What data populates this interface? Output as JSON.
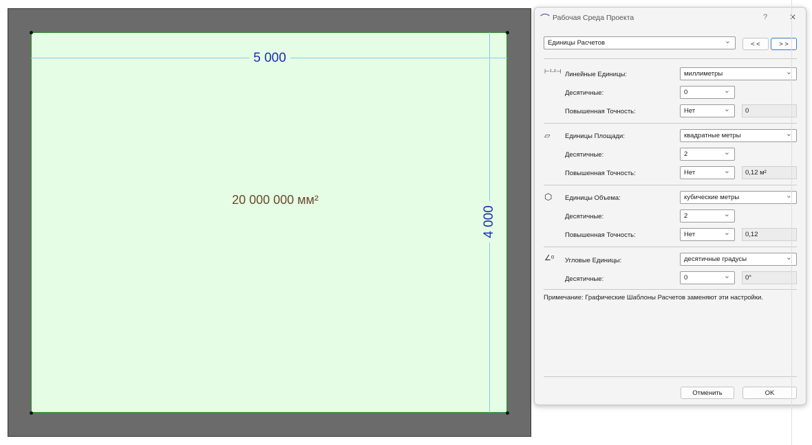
{
  "canvas": {
    "width_label": "5 000",
    "height_label": "4 000",
    "area_label": "20 000 000 мм²"
  },
  "dialog": {
    "title": "Рабочая Среда Проекта",
    "help": "?",
    "close": "✕",
    "page_select": "Единицы Расчетов",
    "prev": "< <",
    "next": "> >",
    "linear": {
      "label": "Линейные Единицы:",
      "value": "миллиметры",
      "decimals_label": "Десятичные:",
      "decimals": "0",
      "precision_label": "Повышенная Точность:",
      "precision": "Нет",
      "preview": "0"
    },
    "area": {
      "label": "Единицы Площади:",
      "value": "квадратные метры",
      "decimals_label": "Десятичные:",
      "decimals": "2",
      "precision_label": "Повышенная Точность:",
      "precision": "Нет",
      "preview": "0,12 м²"
    },
    "volume": {
      "label": "Единицы Объема:",
      "value": "кубические метры",
      "decimals_label": "Десятичные:",
      "decimals": "2",
      "precision_label": "Повышенная Точность:",
      "precision": "Нет",
      "preview": "0,12"
    },
    "angle": {
      "label": "Угловые Единицы:",
      "value": "десятичные градусы",
      "decimals_label": "Десятичные:",
      "decimals": "0",
      "preview": "0°"
    },
    "note": "Примечание: Графические Шаблоны Расчетов заменяют эти настройки.",
    "cancel": "Отменить",
    "ok": "OK"
  }
}
